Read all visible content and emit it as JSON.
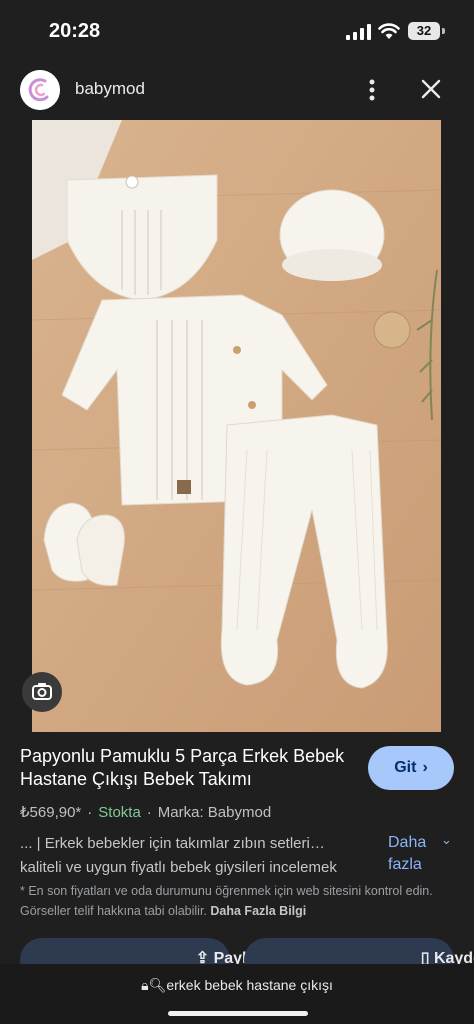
{
  "status_bar": {
    "time": "20:28",
    "battery": "32"
  },
  "header": {
    "site_name": "babymod"
  },
  "product": {
    "title": "Papyonlu Pamuklu 5 Parça Erkek Bebek Hastane Çıkışı Bebek Takımı",
    "price": "₺569,90*",
    "stock": "Stokta",
    "brand": "Marka: Babymod",
    "visit_label": "Git"
  },
  "description": {
    "line1": "... | Erkek bebekler için takımlar zıbın setleri…",
    "line2": "kaliteli ve uygun fiyatlı bebek giysileri incelemek",
    "more_label": "Daha fazla"
  },
  "notice": {
    "text": "* En son fiyatları ve oda durumunu öğrenmek için web sitesini kontrol edin. Görseller telif hakkına tabi olabilir.",
    "link": "Daha Fazla Bilgi"
  },
  "actions": {
    "share_label": "Paylaş",
    "save_label": "Kaydet"
  },
  "url_bar": {
    "text": "erkek bebek hastane çıkışı"
  },
  "colors": {
    "accent": "#a8c7fa",
    "stock": "#81c995",
    "link": "#8ab4f8",
    "background": "#1f1f1f"
  }
}
